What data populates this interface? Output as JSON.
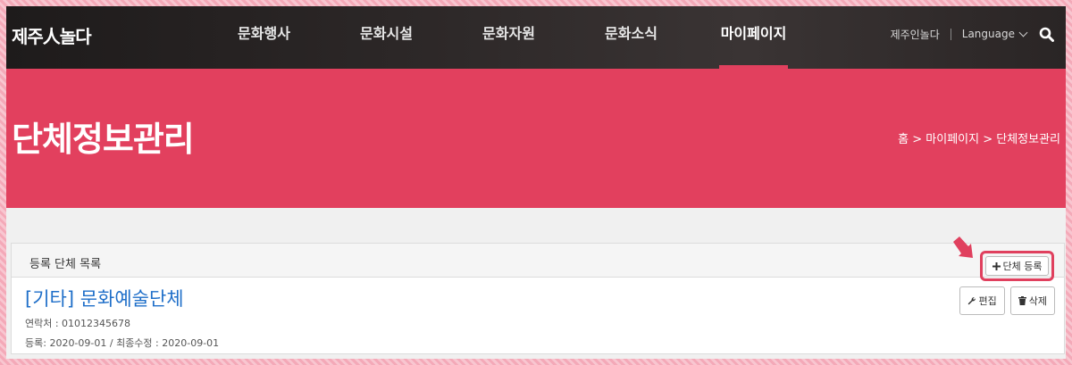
{
  "header": {
    "logo": "제주人놀다",
    "nav": [
      "문화행사",
      "문화시설",
      "문화자원",
      "문화소식",
      "마이페이지"
    ],
    "util_link": "제주인놀다",
    "language": "Language"
  },
  "banner": {
    "title": "단체정보관리",
    "breadcrumb": "홈 > 마이페이지 > 단체정보관리"
  },
  "panel": {
    "title": "등록 단체 목록",
    "register_label": "단체 등록",
    "item": {
      "title": "[기타] 문화예술단체",
      "contact": "연락처 : 01012345678",
      "dates": "등록: 2020-09-01 / 최종수정 : 2020-09-01",
      "edit_label": "편집",
      "delete_label": "삭제"
    }
  },
  "colors": {
    "accent": "#e2405e",
    "link": "#1f6fc9"
  },
  "icons": [
    "search-icon",
    "chevron-down-icon",
    "plus-icon",
    "wrench-icon",
    "trash-icon",
    "pointer-arrow-icon"
  ]
}
